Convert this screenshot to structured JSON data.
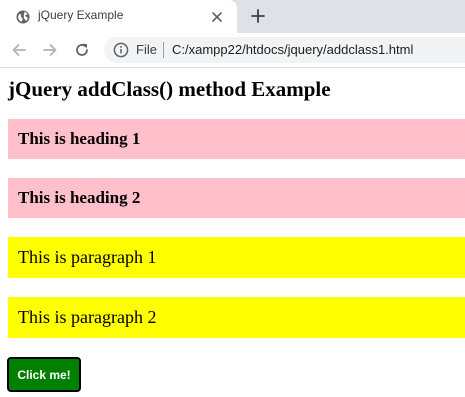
{
  "browser": {
    "tab": {
      "title": "jQuery Example",
      "favicon_icon": "globe-icon",
      "close_icon": "close-icon"
    },
    "new_tab_icon": "plus-icon",
    "toolbar": {
      "back_icon": "arrow-left-icon",
      "forward_icon": "arrow-right-icon",
      "reload_icon": "reload-icon",
      "info_icon": "info-icon",
      "scheme_label": "File",
      "url": "C:/xampp22/htdocs/jquery/addclass1.html"
    }
  },
  "page": {
    "title": "jQuery addClass() method Example",
    "headings": [
      {
        "text": "This is heading 1"
      },
      {
        "text": "This is heading 2"
      }
    ],
    "paragraphs": [
      {
        "text": "This is paragraph 1"
      },
      {
        "text": "This is paragraph 2"
      }
    ],
    "button_label": "Click me!"
  },
  "colors": {
    "heading_background": "#ffc0cb",
    "paragraph_background": "#ffff00",
    "button_background": "#008000",
    "button_text": "#ffffff"
  }
}
